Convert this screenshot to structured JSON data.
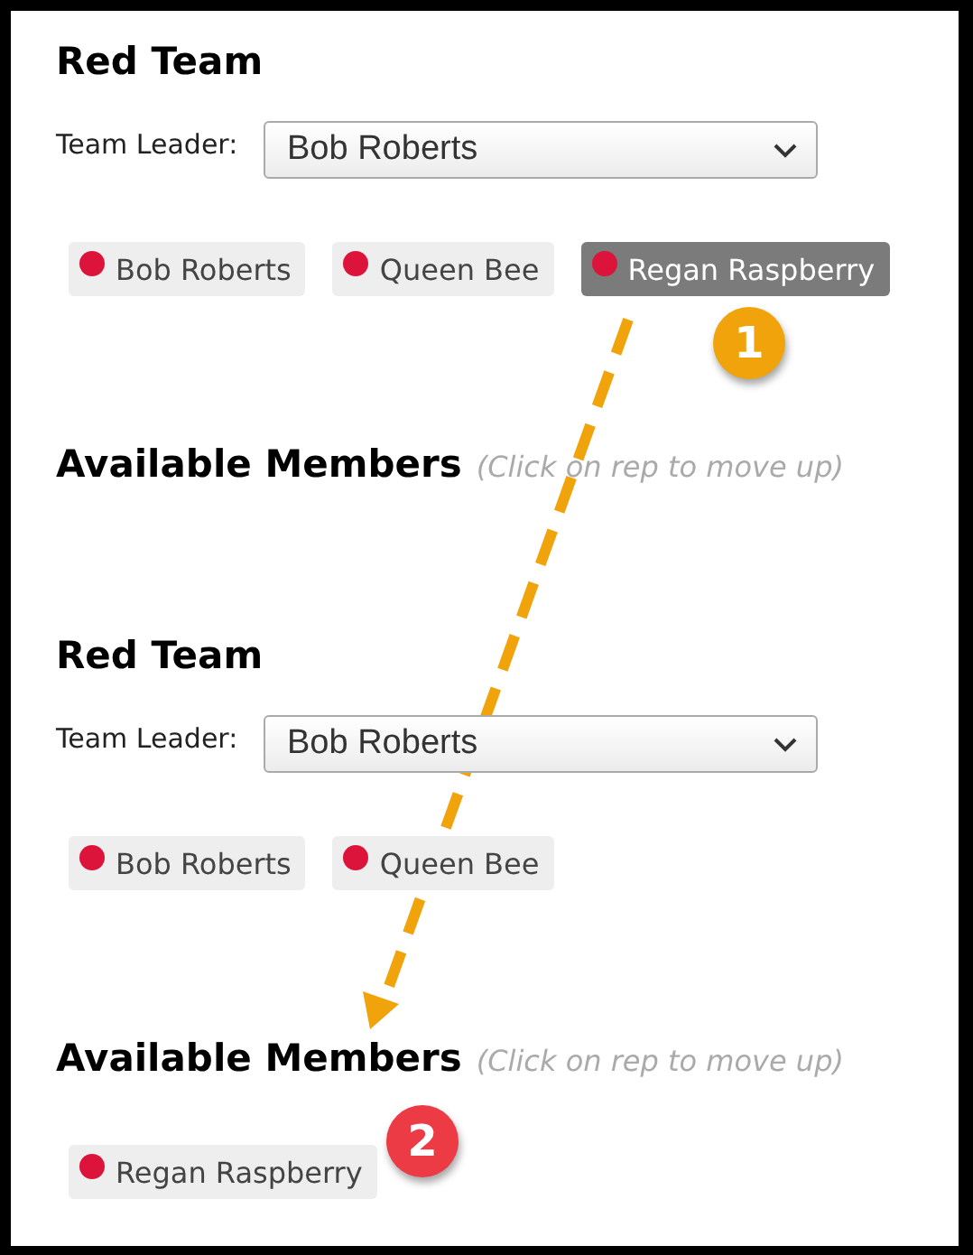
{
  "panels": [
    {
      "title": "Red Team",
      "leader_label": "Team Leader:",
      "leader": "Bob Roberts",
      "members": [
        {
          "name": "Bob Roberts",
          "selected": false
        },
        {
          "name": "Queen Bee",
          "selected": false
        },
        {
          "name": "Regan Raspberry",
          "selected": true
        }
      ],
      "available_title": "Available Members",
      "available_hint": "(Click on rep to move up)"
    },
    {
      "title": "Red Team",
      "leader_label": "Team Leader:",
      "leader": "Bob Roberts",
      "members": [
        {
          "name": "Bob Roberts",
          "selected": false
        },
        {
          "name": "Queen Bee",
          "selected": false
        }
      ],
      "available_title": "Available Members",
      "available_hint": "(Click on rep to move up)",
      "available": [
        {
          "name": "Regan Raspberry",
          "selected": false
        }
      ]
    }
  ],
  "callouts": [
    {
      "label": "1",
      "color": "#f0a30a"
    },
    {
      "label": "2",
      "color": "#ec3b45"
    }
  ]
}
